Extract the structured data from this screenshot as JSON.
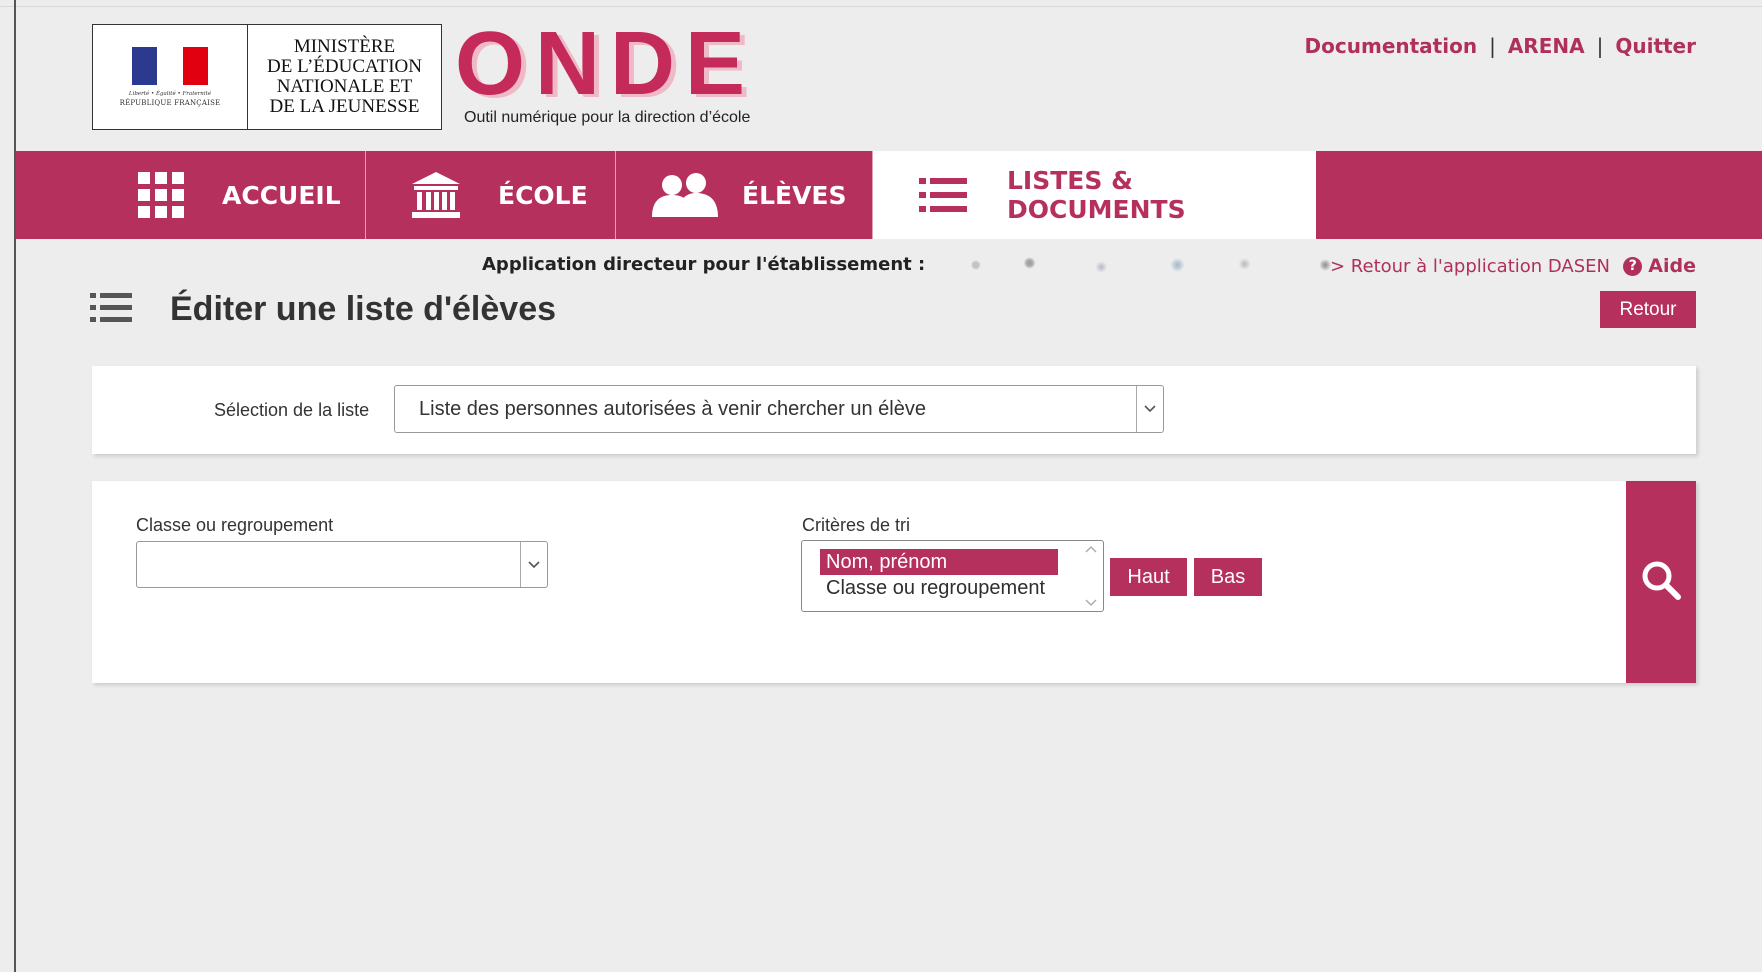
{
  "header": {
    "ministere": "MINISTÈRE\nDE L’ÉDUCATION\nNATIONALE ET\nDE LA JEUNESSE",
    "marianne_motto": "Liberté • Égalité • Fraternité",
    "marianne_republique": "RÉPUBLIQUE FRANÇAISE",
    "app_name": "ONDE",
    "app_subtitle": "Outil numérique pour la direction d’école",
    "links": {
      "documentation": "Documentation",
      "arena": "ARENA",
      "quitter": "Quitter",
      "separator": "|"
    }
  },
  "nav": {
    "items": [
      {
        "label": "ACCUEIL",
        "icon": "grid-icon"
      },
      {
        "label": "ÉCOLE",
        "icon": "building-icon"
      },
      {
        "label": "ÉLÈVES",
        "icon": "users-icon"
      },
      {
        "label": "LISTES & DOCUMENTS",
        "icon": "list-icon",
        "active": true
      }
    ]
  },
  "subheader": {
    "app_label": "Application directeur pour l'établissement :",
    "retour_dasen": "> Retour à l'application DASEN",
    "aide": "Aide"
  },
  "page": {
    "title": "Éditer une liste d'élèves",
    "retour": "Retour"
  },
  "form": {
    "selection_label": "Sélection de la liste",
    "selection_value": "Liste des personnes autorisées à venir chercher un élève",
    "classe_label": "Classe ou regroupement",
    "classe_value": "",
    "criteres_label": "Critères de tri",
    "criteres_options": [
      "Nom, prénom",
      "Classe ou regroupement"
    ],
    "haut": "Haut",
    "bas": "Bas"
  },
  "colors": {
    "brand": "#b5305d",
    "background": "#ededed"
  }
}
